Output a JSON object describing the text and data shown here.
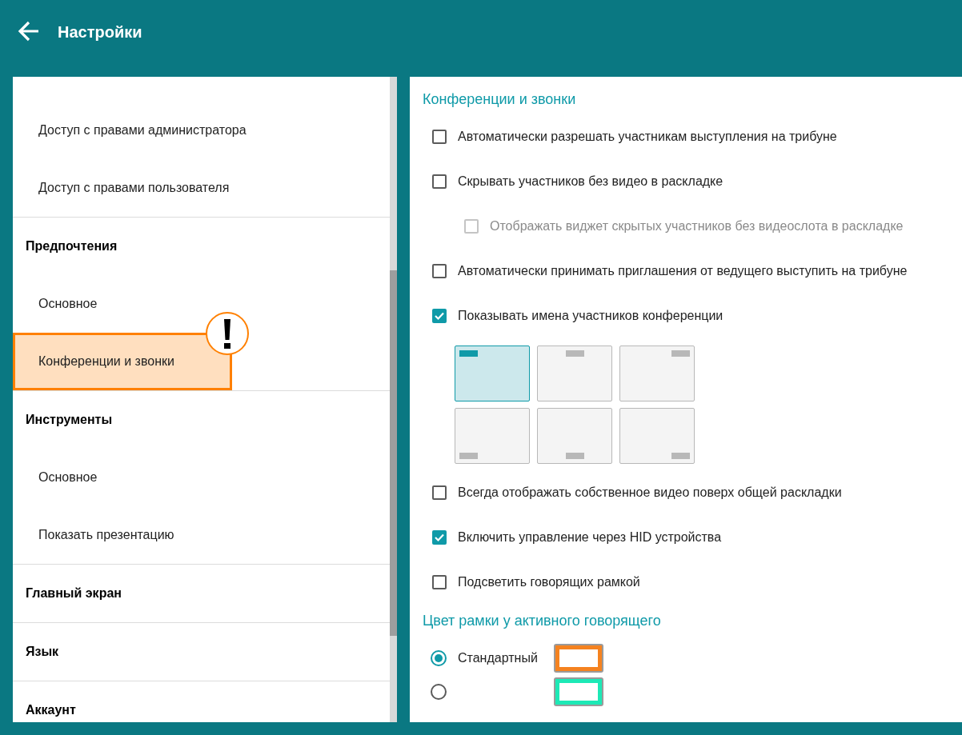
{
  "header": {
    "title": "Настройки"
  },
  "sidebar": {
    "sections": [
      {
        "items": [
          {
            "label": "Доступ с правами администратора",
            "selected": false,
            "warning": false
          },
          {
            "label": "Доступ с правами пользователя",
            "selected": false,
            "warning": false
          }
        ]
      },
      {
        "heading": "Предпочтения",
        "items": [
          {
            "label": "Основное",
            "selected": false,
            "warning": false
          },
          {
            "label": "Конференции и звонки",
            "selected": true,
            "warning": true
          }
        ]
      },
      {
        "heading": "Инструменты",
        "items": [
          {
            "label": "Основное",
            "selected": false,
            "warning": false
          },
          {
            "label": "Показать презентацию",
            "selected": false,
            "warning": false
          }
        ]
      },
      {
        "heading": "Главный экран"
      },
      {
        "heading": "Язык"
      },
      {
        "heading": "Аккаунт"
      }
    ]
  },
  "content": {
    "section_title": "Конференции и звонки",
    "options": [
      {
        "kind": "checkbox",
        "label": "Автоматически разрешать участникам выступления на трибуне",
        "checked": false
      },
      {
        "kind": "checkbox",
        "label": "Скрывать участников без видео в раскладке",
        "checked": false,
        "children": [
          {
            "kind": "checkbox",
            "label": "Отображать виджет скрытых участников без видеослота в раскладке",
            "checked": false,
            "disabled": true
          }
        ]
      },
      {
        "kind": "checkbox",
        "label": "Автоматически принимать приглашения от ведущего выступить на трибуне",
        "checked": false
      },
      {
        "kind": "checkbox",
        "label": "Показывать имена участников конференции",
        "checked": true
      },
      {
        "kind": "layout_picker",
        "tiles": [
          {
            "kind": "topleft",
            "selected": true
          },
          {
            "kind": "topcenter",
            "selected": false
          },
          {
            "kind": "topright",
            "selected": false
          },
          {
            "kind": "bottomleft",
            "selected": false
          },
          {
            "kind": "bottomcenter",
            "selected": false
          },
          {
            "kind": "bottomright",
            "selected": false
          }
        ]
      },
      {
        "kind": "checkbox",
        "label": "Всегда отображать собственное видео поверх общей раскладки",
        "checked": false
      },
      {
        "kind": "checkbox",
        "label": "Включить управление через HID устройства",
        "checked": true
      },
      {
        "kind": "checkbox",
        "label": "Подсветить говорящих рамкой",
        "checked": false
      }
    ],
    "frame_color": {
      "title": "Цвет рамки у активного говорящего",
      "options": [
        {
          "label": "Стандартный",
          "selected": true,
          "color": "#f5821f"
        },
        {
          "selected": false,
          "color": "#1de9b6"
        }
      ]
    }
  }
}
